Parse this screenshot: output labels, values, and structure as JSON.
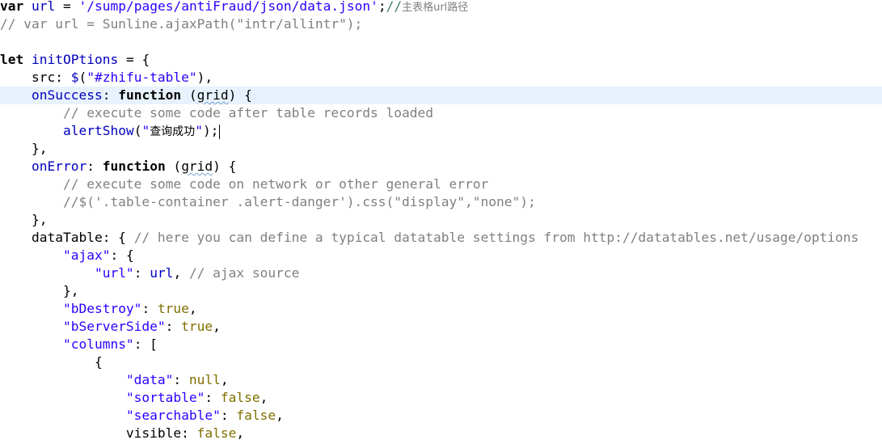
{
  "editor": {
    "caret_line": 5,
    "lines": [
      [
        {
          "t": "var",
          "c": "kw"
        },
        {
          "t": " ",
          "c": "plain"
        },
        {
          "t": "url",
          "c": "var"
        },
        {
          "t": " = ",
          "c": "plain"
        },
        {
          "t": "'/sump/pages/antiFraud/json/data.json'",
          "c": "str"
        },
        {
          "t": ";",
          "c": "plain"
        },
        {
          "t": "//",
          "c": "comment"
        },
        {
          "t": "主表格url路径",
          "c": "cmt-cn"
        }
      ],
      [
        {
          "t": "// var url = Sunline.ajaxPath(\"intr/allintr\");",
          "c": "comment-gray"
        }
      ],
      [],
      [
        {
          "t": "let",
          "c": "kw"
        },
        {
          "t": " ",
          "c": "plain"
        },
        {
          "t": "initOPtions",
          "c": "var"
        },
        {
          "t": " = {",
          "c": "plain"
        }
      ],
      [
        {
          "t": "    src: ",
          "c": "plain"
        },
        {
          "t": "$",
          "c": "fn"
        },
        {
          "t": "(",
          "c": "plain"
        },
        {
          "t": "\"#zhifu-table\"",
          "c": "str"
        },
        {
          "t": "),",
          "c": "plain"
        }
      ],
      [
        {
          "t": "    ",
          "c": "plain"
        },
        {
          "t": "onSuccess",
          "c": "prop"
        },
        {
          "t": ": ",
          "c": "plain"
        },
        {
          "t": "function",
          "c": "kw"
        },
        {
          "t": " (",
          "c": "plain"
        },
        {
          "t": "grid",
          "c": "squiggle"
        },
        {
          "t": ") {",
          "c": "plain"
        }
      ],
      [
        {
          "t": "        // execute some code after table records loaded",
          "c": "comment-gray"
        }
      ],
      [
        {
          "t": "        ",
          "c": "plain"
        },
        {
          "t": "alertShow",
          "c": "fn"
        },
        {
          "t": "(",
          "c": "plain"
        },
        {
          "t": "\"",
          "c": "str"
        },
        {
          "t": "查询成功",
          "c": "str-cn"
        },
        {
          "t": "\"",
          "c": "str"
        },
        {
          "t": ");",
          "c": "plain"
        },
        {
          "t": "",
          "c": "caret"
        }
      ],
      [
        {
          "t": "    },",
          "c": "plain"
        }
      ],
      [
        {
          "t": "    ",
          "c": "plain"
        },
        {
          "t": "onError",
          "c": "prop"
        },
        {
          "t": ": ",
          "c": "plain"
        },
        {
          "t": "function",
          "c": "kw"
        },
        {
          "t": " (",
          "c": "plain"
        },
        {
          "t": "grid",
          "c": "squiggle"
        },
        {
          "t": ") {",
          "c": "plain"
        }
      ],
      [
        {
          "t": "        // execute some code on network or other general error",
          "c": "comment-gray"
        }
      ],
      [
        {
          "t": "        //$('.table-container .alert-danger').css(\"display\",\"none\");",
          "c": "comment-gray"
        }
      ],
      [
        {
          "t": "    },",
          "c": "plain"
        }
      ],
      [
        {
          "t": "    dataTable: { ",
          "c": "plain"
        },
        {
          "t": "// here you can define a typical datatable settings from http://datatables.net/usage/options",
          "c": "comment-gray"
        }
      ],
      [
        {
          "t": "        ",
          "c": "plain"
        },
        {
          "t": "\"ajax\"",
          "c": "str"
        },
        {
          "t": ": {",
          "c": "plain"
        }
      ],
      [
        {
          "t": "            ",
          "c": "plain"
        },
        {
          "t": "\"url\"",
          "c": "str"
        },
        {
          "t": ": ",
          "c": "plain"
        },
        {
          "t": "url",
          "c": "var"
        },
        {
          "t": ", ",
          "c": "plain"
        },
        {
          "t": "// ajax source",
          "c": "comment-gray"
        }
      ],
      [
        {
          "t": "        },",
          "c": "plain"
        }
      ],
      [
        {
          "t": "        ",
          "c": "plain"
        },
        {
          "t": "\"bDestroy\"",
          "c": "str"
        },
        {
          "t": ": ",
          "c": "plain"
        },
        {
          "t": "true",
          "c": "lit"
        },
        {
          "t": ",",
          "c": "plain"
        }
      ],
      [
        {
          "t": "        ",
          "c": "plain"
        },
        {
          "t": "\"bServerSide\"",
          "c": "str"
        },
        {
          "t": ": ",
          "c": "plain"
        },
        {
          "t": "true",
          "c": "lit"
        },
        {
          "t": ",",
          "c": "plain"
        }
      ],
      [
        {
          "t": "        ",
          "c": "plain"
        },
        {
          "t": "\"columns\"",
          "c": "str"
        },
        {
          "t": ": [",
          "c": "plain"
        }
      ],
      [
        {
          "t": "            {",
          "c": "plain"
        }
      ],
      [
        {
          "t": "                ",
          "c": "plain"
        },
        {
          "t": "\"data\"",
          "c": "str"
        },
        {
          "t": ": ",
          "c": "plain"
        },
        {
          "t": "null",
          "c": "lit"
        },
        {
          "t": ",",
          "c": "plain"
        }
      ],
      [
        {
          "t": "                ",
          "c": "plain"
        },
        {
          "t": "\"sortable\"",
          "c": "str"
        },
        {
          "t": ": ",
          "c": "plain"
        },
        {
          "t": "false",
          "c": "lit"
        },
        {
          "t": ",",
          "c": "plain"
        }
      ],
      [
        {
          "t": "                ",
          "c": "plain"
        },
        {
          "t": "\"searchable\"",
          "c": "str"
        },
        {
          "t": ": ",
          "c": "plain"
        },
        {
          "t": "false",
          "c": "lit"
        },
        {
          "t": ",",
          "c": "plain"
        }
      ],
      [
        {
          "t": "                visible: ",
          "c": "plain"
        },
        {
          "t": "false",
          "c": "lit"
        },
        {
          "t": ",",
          "c": "plain"
        }
      ]
    ]
  }
}
